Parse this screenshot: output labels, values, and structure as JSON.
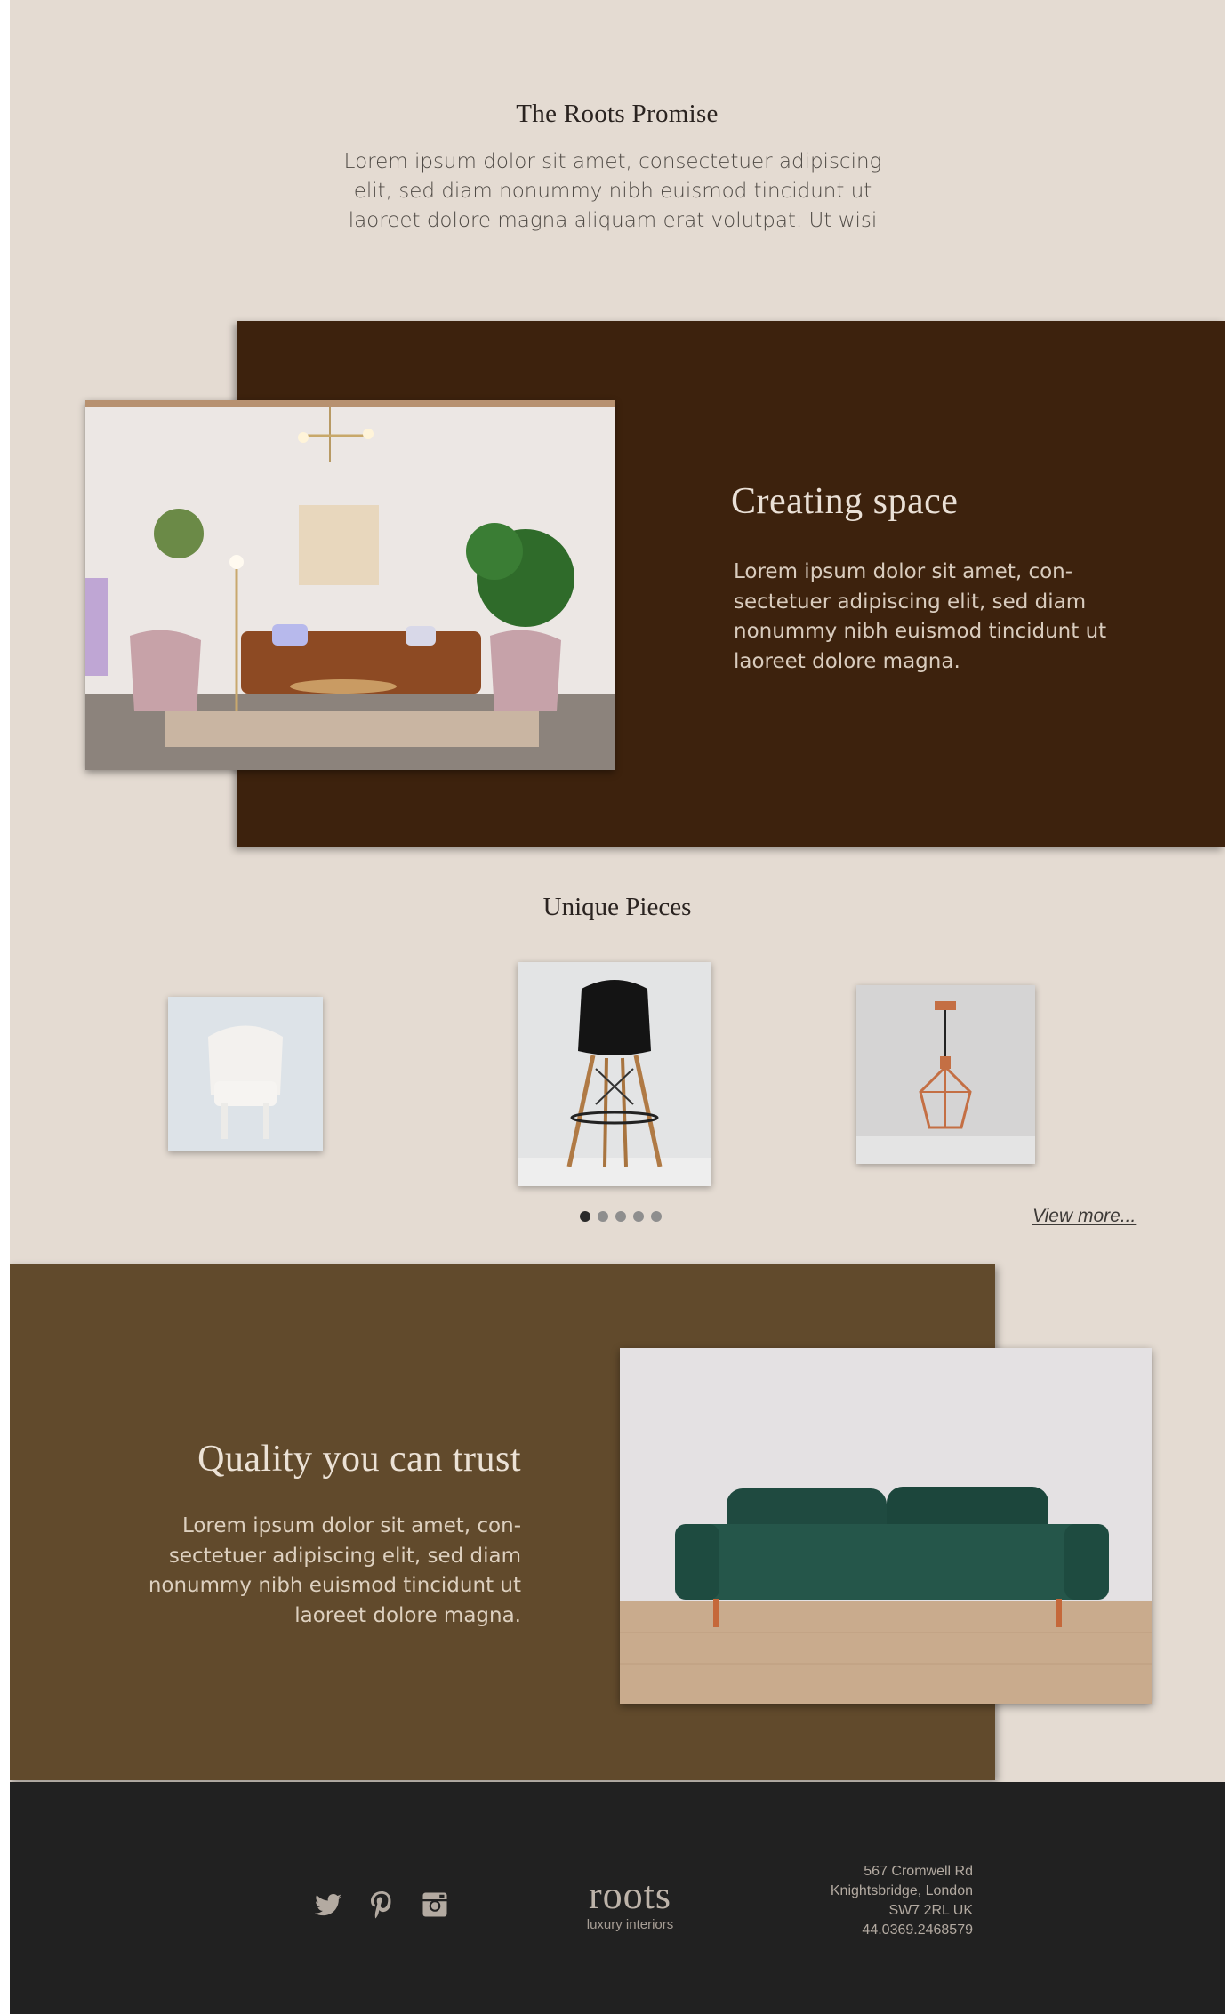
{
  "promise": {
    "title": "The Roots Promise",
    "text": "Lorem ipsum dolor sit amet, consectetuer adipiscing elit, sed diam nonummy nibh euismod tincidunt ut laoreet dolore magna aliquam erat volutpat. Ut wisi"
  },
  "creating_space": {
    "title": "Creating space",
    "text": "Lorem ipsum dolor sit amet, con-sectetuer adipiscing elit, sed diam nonummy nibh euismod tincidunt ut laoreet dolore magna."
  },
  "unique_pieces": {
    "title": "Unique Pieces",
    "items": [
      {
        "icon": "white-armchair-image"
      },
      {
        "icon": "black-barstool-image"
      },
      {
        "icon": "copper-pendant-lamp-image"
      }
    ],
    "carousel_pages": 5,
    "active_page": 1,
    "view_more": "View more..."
  },
  "quality": {
    "title": "Quality you can trust",
    "text": "Lorem ipsum dolor sit amet, con-sectetuer adipiscing elit, sed diam nonummy nibh euismod tincidunt ut laoreet dolore magna."
  },
  "footer": {
    "social": [
      "twitter-icon",
      "pinterest-icon",
      "instagram-icon"
    ],
    "logo": "roots",
    "tagline": "luxury interiors",
    "address": {
      "line1": "567 Cromwell Rd",
      "line2": "Knightsbridge, London",
      "line3": "SW7 2RL UK",
      "phone": "44.0369.2468579"
    }
  },
  "colors": {
    "background": "#e4dbd2",
    "dark_brown_panel": "#3d220d",
    "mid_brown_panel": "#614a2c",
    "footer": "#212121"
  }
}
